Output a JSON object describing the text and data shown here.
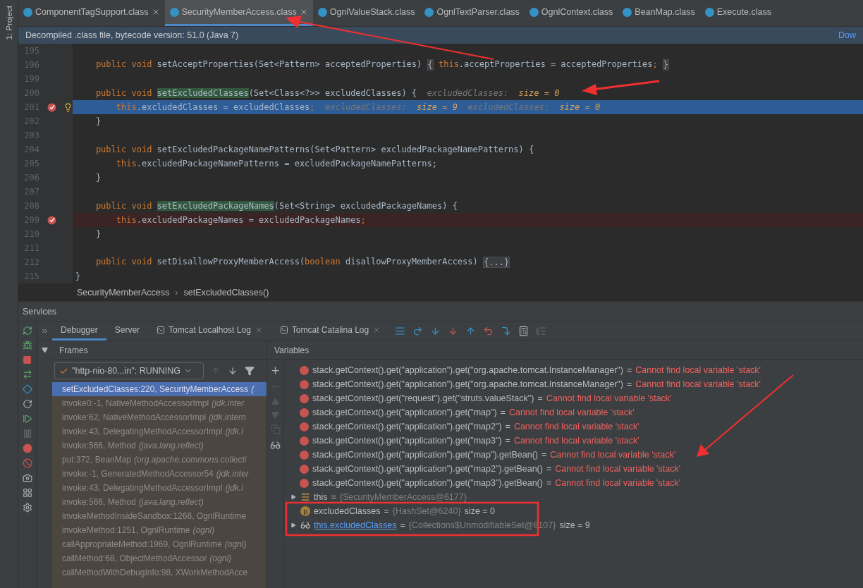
{
  "sidebar_stripe": {
    "label": "1: Project"
  },
  "editor_tabs": [
    {
      "label": "ComponentTagSupport.class",
      "selected": false,
      "closable": true
    },
    {
      "label": "SecurityMemberAccess.class",
      "selected": true,
      "closable": true
    },
    {
      "label": "OgnlValueStack.class",
      "selected": false,
      "closable": false
    },
    {
      "label": "OgnlTextParser.class",
      "selected": false,
      "closable": false
    },
    {
      "label": "OgnlContext.class",
      "selected": false,
      "closable": false
    },
    {
      "label": "BeanMap.class",
      "selected": false,
      "closable": false
    },
    {
      "label": "Execute.class",
      "selected": false,
      "closable": false
    }
  ],
  "banner": {
    "text": "Decompiled .class file, bytecode version: 51.0 (Java 7)",
    "link": "Dow"
  },
  "code_lines": [
    {
      "number": "195",
      "breakpoint": false,
      "current": false
    },
    {
      "number": "196",
      "breakpoint": false,
      "current": false,
      "segments": [
        {
          "kind": "kw",
          "text": "    public void "
        },
        {
          "kind": "txt",
          "text": "setAcceptProperties(Set<Pattern> acceptedProperties) "
        },
        {
          "kind": "fold",
          "text": "{"
        },
        {
          "kind": "kw",
          "text": " this"
        },
        {
          "kind": "txt",
          "text": ".acceptProperties = acceptedProperties"
        },
        {
          "kind": "kw",
          "text": "; "
        },
        {
          "kind": "fold",
          "text": "}"
        }
      ]
    },
    {
      "number": "199",
      "breakpoint": false,
      "current": false
    },
    {
      "number": "200",
      "breakpoint": false,
      "current": false,
      "segments": [
        {
          "kind": "kw",
          "text": "    public void "
        },
        {
          "kind": "decl",
          "text": "setExcludedClasses"
        },
        {
          "kind": "txt",
          "text": "(Set<Class<?>> excludedClasses) {  "
        },
        {
          "kind": "hint",
          "text": "excludedClasses:  "
        },
        {
          "kind": "val",
          "text": "size = 0"
        }
      ]
    },
    {
      "number": "201",
      "breakpoint": true,
      "current": true,
      "segments": [
        {
          "kind": "kw",
          "text": "        this"
        },
        {
          "kind": "txt",
          "text": ".excludedClasses = excludedClasses"
        },
        {
          "kind": "kw",
          "text": ";  "
        },
        {
          "kind": "hint",
          "text": "excludedClasses:  "
        },
        {
          "kind": "val",
          "text": "size = 9  "
        },
        {
          "kind": "hint",
          "text": "excludedClasses:  "
        },
        {
          "kind": "val",
          "text": "size = 0"
        }
      ]
    },
    {
      "number": "202",
      "breakpoint": false,
      "current": false,
      "segments": [
        {
          "kind": "txt",
          "text": "    }"
        }
      ]
    },
    {
      "number": "203",
      "breakpoint": false,
      "current": false
    },
    {
      "number": "204",
      "breakpoint": false,
      "current": false,
      "segments": [
        {
          "kind": "kw",
          "text": "    public void "
        },
        {
          "kind": "txt",
          "text": "setExcludedPackageNamePatterns(Set<Pattern> excludedPackageNamePatterns) {"
        }
      ]
    },
    {
      "number": "205",
      "breakpoint": false,
      "current": false,
      "segments": [
        {
          "kind": "kw",
          "text": "        this"
        },
        {
          "kind": "txt",
          "text": ".excludedPackageNamePatterns = excludedPackageNamePatterns;"
        }
      ]
    },
    {
      "number": "206",
      "breakpoint": false,
      "current": false,
      "segments": [
        {
          "kind": "txt",
          "text": "    }"
        }
      ]
    },
    {
      "number": "207",
      "breakpoint": false,
      "current": false
    },
    {
      "number": "208",
      "breakpoint": false,
      "current": false,
      "segments": [
        {
          "kind": "kw",
          "text": "    public void "
        },
        {
          "kind": "decl",
          "text": "setExcludedPackageNames"
        },
        {
          "kind": "txt",
          "text": "(Set<String> excludedPackageNames) {"
        }
      ]
    },
    {
      "number": "209",
      "breakpoint": true,
      "current": false,
      "segments": [
        {
          "kind": "kw",
          "text": "        this"
        },
        {
          "kind": "txt",
          "text": ".excludedPackageNames = excludedPackageNames"
        },
        {
          "kind": "kw",
          "text": ";"
        }
      ]
    },
    {
      "number": "210",
      "breakpoint": false,
      "current": false,
      "segments": [
        {
          "kind": "txt",
          "text": "    }"
        }
      ]
    },
    {
      "number": "211",
      "breakpoint": false,
      "current": false
    },
    {
      "number": "212",
      "breakpoint": false,
      "current": false,
      "segments": [
        {
          "kind": "kw",
          "text": "    public void "
        },
        {
          "kind": "txt",
          "text": "setDisallowProxyMemberAccess("
        },
        {
          "kind": "kw",
          "text": "boolean"
        },
        {
          "kind": "txt",
          "text": " disallowProxyMemberAccess) "
        },
        {
          "kind": "fold",
          "text": "{...}"
        }
      ]
    },
    {
      "number": "215",
      "breakpoint": false,
      "current": false,
      "segments": [
        {
          "kind": "txt",
          "text": "}"
        }
      ]
    }
  ],
  "breadcrumb": {
    "separator": "›",
    "items": [
      "SecurityMemberAccess",
      "setExcludedClasses()"
    ]
  },
  "services": {
    "title": "Services"
  },
  "debug_tabs": [
    {
      "label": "Debugger",
      "kind": "plain",
      "selected": true
    },
    {
      "label": "Server",
      "kind": "plain",
      "selected": false
    },
    {
      "label": "Tomcat Localhost Log",
      "kind": "log",
      "selected": false
    },
    {
      "label": "Tomcat Catalina Log",
      "kind": "log",
      "selected": false
    }
  ],
  "frames": {
    "title": "Frames",
    "thread": "\"http-nio-80...in\": RUNNING",
    "items": [
      {
        "method": "setExcludedClasses:220, SecurityMemberAccess",
        "package": "(",
        "selected": true
      },
      {
        "method": "invoke0:-1, NativeMethodAccessorImpl",
        "package": "(jdk.inter",
        "selected": false
      },
      {
        "method": "invoke:62, NativeMethodAccessorImpl",
        "package": "(jdk.intern",
        "selected": false
      },
      {
        "method": "invoke:43, DelegatingMethodAccessorImpl",
        "package": "(jdk.i",
        "selected": false
      },
      {
        "method": "invoke:566, Method",
        "package": "(java.lang.reflect)",
        "selected": false
      },
      {
        "method": "put:372, BeanMap",
        "package": "(org.apache.commons.collecti",
        "selected": false
      },
      {
        "method": "invoke:-1, GeneratedMethodAccessor54",
        "package": "(jdk.inter",
        "selected": false
      },
      {
        "method": "invoke:43, DelegatingMethodAccessorImpl",
        "package": "(jdk.i",
        "selected": false
      },
      {
        "method": "invoke:566, Method",
        "package": "(java.lang.reflect)",
        "selected": false
      },
      {
        "method": "invokeMethodInsideSandbox:1266, OgnlRuntime",
        "selected": false
      },
      {
        "method": "invokeMethod:1251, OgnlRuntime",
        "package": "(ognl)",
        "selected": false
      },
      {
        "method": "callAppropriateMethod:1969, OgnlRuntime",
        "package": "(ognl)",
        "selected": false
      },
      {
        "method": "callMethod:68, ObjectMethodAccessor",
        "package": "(ognl)",
        "selected": false
      },
      {
        "method": "callMethodWithDebugInfo:98, XWorkMethodAcce",
        "selected": false
      }
    ]
  },
  "variables": {
    "title": "Variables",
    "watches": [
      {
        "expression": "stack.getContext().get(\"application\").get(\"org.apache.tomcat.InstanceManager\")",
        "sign": "=",
        "message": "Cannot find local variable 'stack'"
      },
      {
        "expression": "stack.getContext().get(\"application\").get(\"org.apache.tomcat.InstanceManager\")",
        "sign": "=",
        "message": "Cannot find local variable 'stack'"
      },
      {
        "expression": "stack.getContext().get(\"request\").get(\"struts.valueStack\")",
        "sign": "=",
        "message": "Cannot find local variable 'stack'"
      },
      {
        "expression": "stack.getContext().get(\"application\").get(\"map\")",
        "sign": "=",
        "message": "Cannot find local variable 'stack'"
      },
      {
        "expression": "stack.getContext().get(\"application\").get(\"map2\")",
        "sign": "=",
        "message": "Cannot find local variable 'stack'"
      },
      {
        "expression": "stack.getContext().get(\"application\").get(\"map3\")",
        "sign": "=",
        "message": "Cannot find local variable 'stack'"
      },
      {
        "expression": "stack.getContext().get(\"application\").get(\"map\").getBean()",
        "sign": "=",
        "message": "Cannot find local variable 'stack'"
      },
      {
        "expression": "stack.getContext().get(\"application\").get(\"map2\").getBean()",
        "sign": "=",
        "message": "Cannot find local variable 'stack'"
      },
      {
        "expression": "stack.getContext().get(\"application\").get(\"map3\").getBean()",
        "sign": "=",
        "message": "Cannot find local variable 'stack'"
      }
    ],
    "nodes": [
      {
        "kind": "field",
        "name": "this",
        "sign": "=",
        "value": "{SecurityMemberAccess@6177}",
        "expandable": true
      },
      {
        "kind": "param",
        "icon_letter": "p",
        "name": "excludedClasses",
        "sign": "=",
        "value": "{HashSet@6240}",
        "size": "size = 0",
        "expandable": false
      },
      {
        "kind": "watch",
        "name": "this.excludedClasses",
        "sign": "=",
        "value": "{Collections$UnmodifiableSet@6107}",
        "size": "size = 9",
        "expandable": true
      }
    ]
  }
}
